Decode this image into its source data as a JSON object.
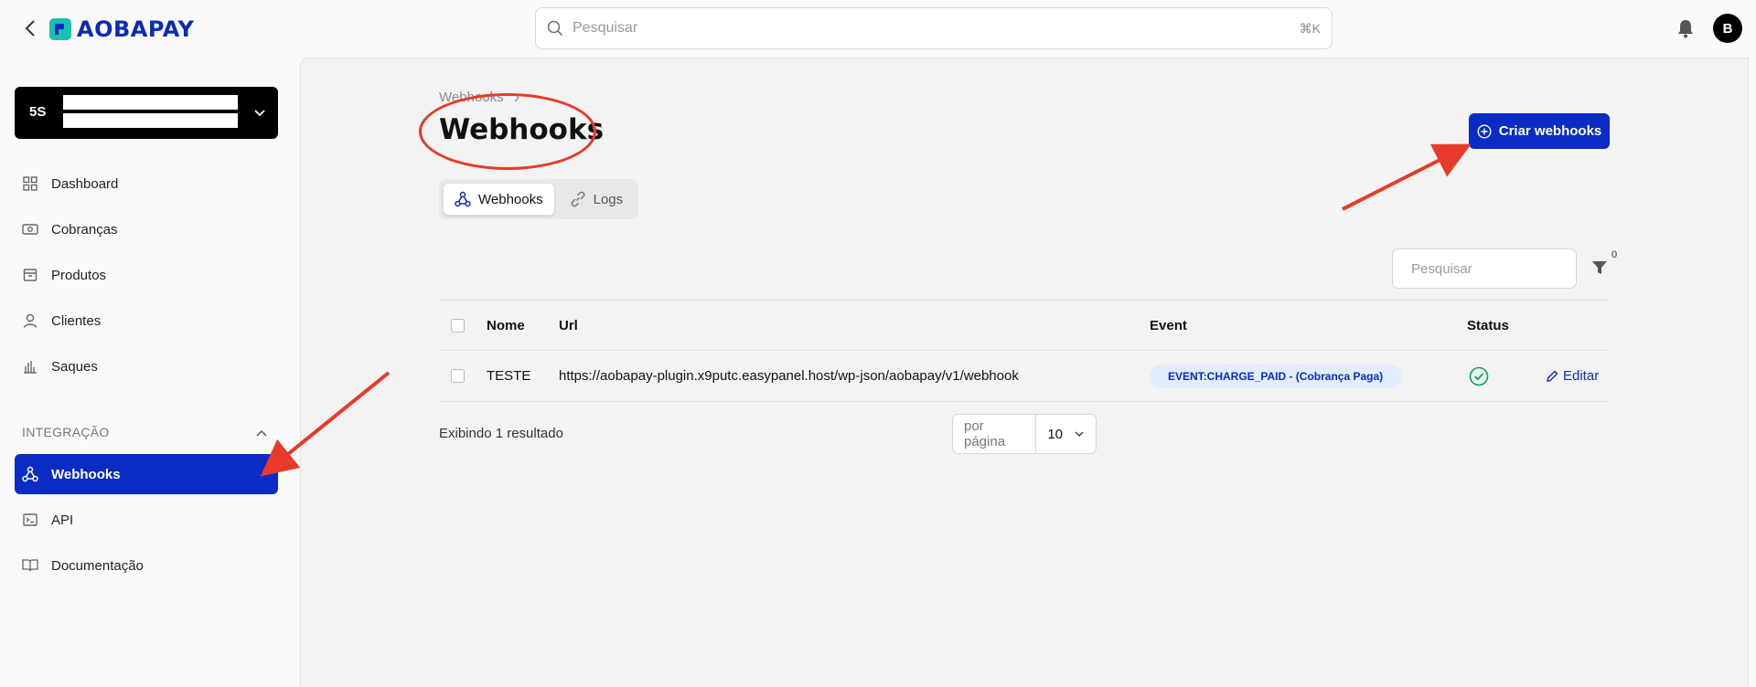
{
  "header": {
    "logo_text": "AOBAPAY",
    "search_placeholder": "Pesquisar",
    "search_shortcut": "⌘K",
    "avatar_initial": "B"
  },
  "sidebar": {
    "account_initials": "5S",
    "items": [
      {
        "label": "Dashboard",
        "icon": "grid-icon"
      },
      {
        "label": "Cobranças",
        "icon": "money-icon"
      },
      {
        "label": "Produtos",
        "icon": "box-icon"
      },
      {
        "label": "Clientes",
        "icon": "user-icon"
      },
      {
        "label": "Saques",
        "icon": "withdraw-icon"
      }
    ],
    "section_label": "INTEGRAÇÃO",
    "integration_items": [
      {
        "label": "Webhooks",
        "icon": "webhook-icon",
        "active": true
      },
      {
        "label": "API",
        "icon": "terminal-icon"
      },
      {
        "label": "Documentação",
        "icon": "book-icon"
      }
    ]
  },
  "main": {
    "breadcrumb": "Webhooks",
    "title": "Webhooks",
    "create_button": "Criar webhooks",
    "tabs": [
      {
        "label": "Webhooks",
        "active": true
      },
      {
        "label": "Logs",
        "active": false
      }
    ],
    "search_placeholder": "Pesquisar",
    "filter_count": "0",
    "table": {
      "columns": [
        "Nome",
        "Url",
        "Event",
        "Status"
      ],
      "rows": [
        {
          "name": "TESTE",
          "url": "https://aobapay-plugin.x9putc.easypanel.host/wp-json/aobapay/v1/webhook",
          "event": "EVENT:CHARGE_PAID - (Cobrança Paga)",
          "status": "active",
          "action": "Editar"
        }
      ]
    },
    "results_text": "Exibindo 1 resultado",
    "per_page_label": "por página",
    "per_page_value": "10"
  },
  "colors": {
    "accent": "#0a2bc4",
    "annotation": "#e63a2a",
    "status_ok": "#1a9c5a"
  }
}
